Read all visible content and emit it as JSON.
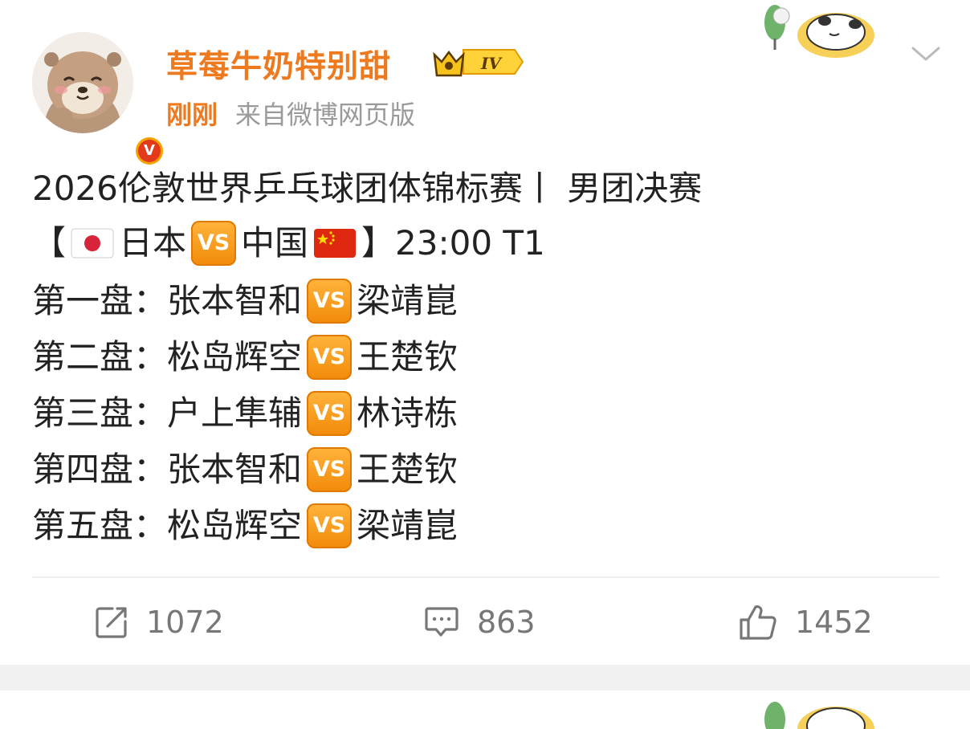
{
  "post": {
    "username": "草莓牛奶特别甜",
    "level_badge": "IV",
    "verified_badge": "V",
    "time": "刚刚",
    "source": "来自微博网页版",
    "title_line": "2026伦敦世界乒乓球团体锦标赛丨 男团决赛",
    "header": {
      "open_bracket": "【",
      "team1": "日本",
      "vs": "VS",
      "team2": "中国",
      "close_bracket_time": "】23:00 T1"
    },
    "matches": [
      {
        "label": "第一盘：",
        "player1": "张本智和",
        "vs": "VS",
        "player2": "梁靖崑"
      },
      {
        "label": "第二盘：",
        "player1": "松岛辉空",
        "vs": "VS",
        "player2": "王楚钦"
      },
      {
        "label": "第三盘：",
        "player1": "户上隼辅",
        "vs": "VS",
        "player2": "林诗栋"
      },
      {
        "label": "第四盘：",
        "player1": "张本智和",
        "vs": "VS",
        "player2": "王楚钦"
      },
      {
        "label": "第五盘：",
        "player1": "松岛辉空",
        "vs": "VS",
        "player2": "梁靖崑"
      }
    ]
  },
  "actions": {
    "repost_count": "1072",
    "comment_count": "863",
    "like_count": "1452"
  },
  "icons": {
    "repost": "repost-icon",
    "comment": "comment-icon",
    "like": "thumbs-up-icon",
    "menu": "chevron-down-icon",
    "jp_flag": "japan-flag-icon",
    "cn_flag": "china-flag-icon"
  },
  "colors": {
    "accent": "#ee7a1f",
    "vs_badge": "#f28a0a",
    "muted": "#9a9a9a"
  }
}
